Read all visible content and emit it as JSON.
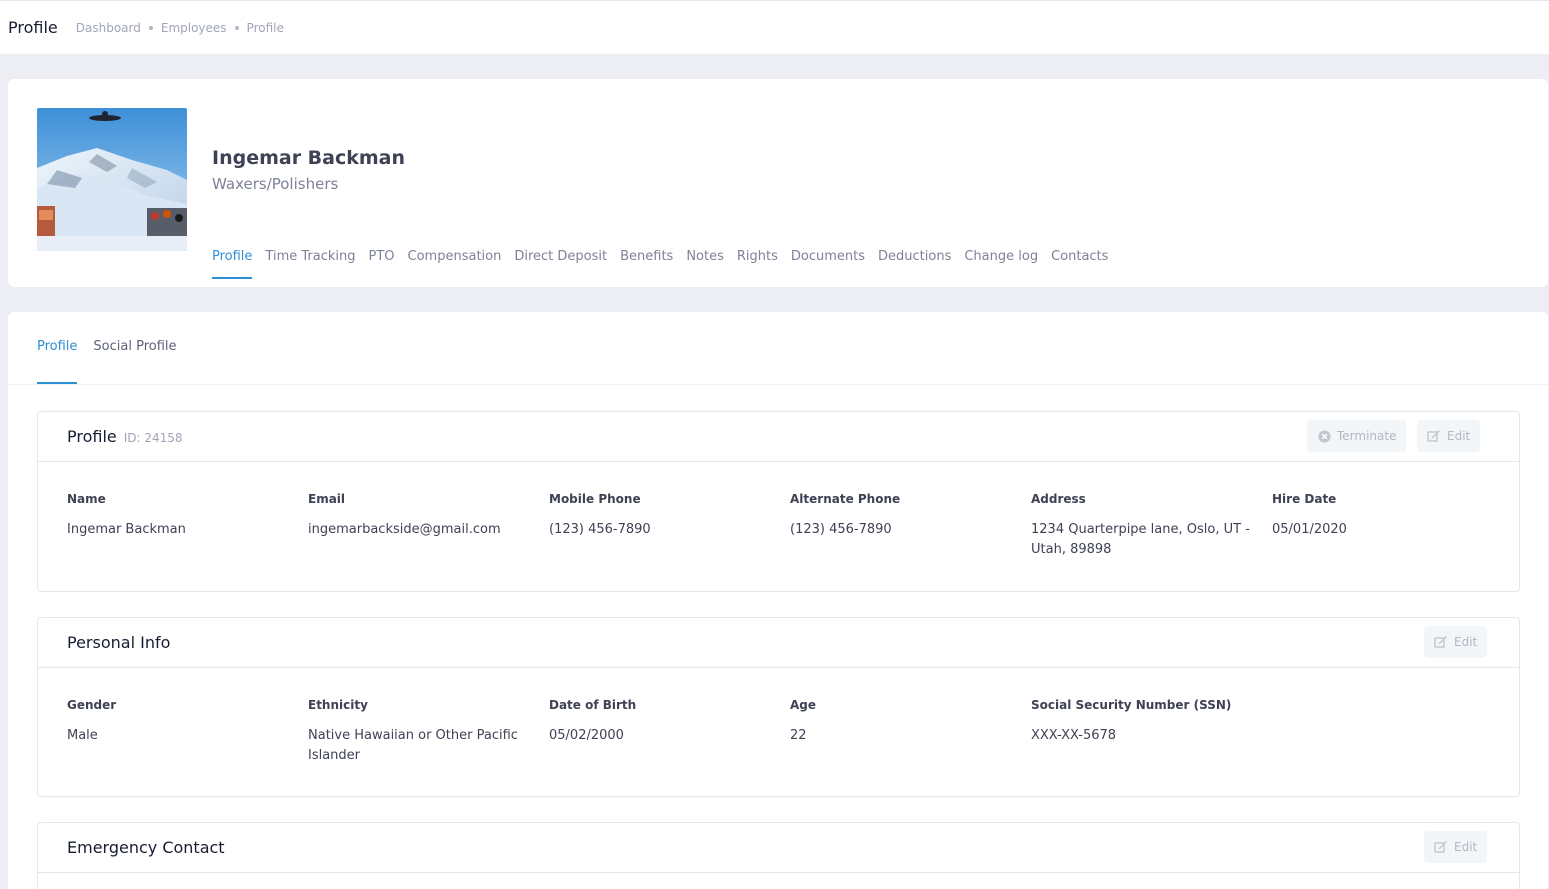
{
  "topbar": {
    "title": "Profile",
    "breadcrumbs": [
      "Dashboard",
      "Employees",
      "Profile"
    ]
  },
  "employee": {
    "name": "Ingemar Backman",
    "role": "Waxers/Polishers",
    "avatar_icon": "profile-photo-snowboarder"
  },
  "main_tabs": [
    {
      "label": "Profile",
      "active": true
    },
    {
      "label": "Time Tracking"
    },
    {
      "label": "PTO"
    },
    {
      "label": "Compensation"
    },
    {
      "label": "Direct Deposit"
    },
    {
      "label": "Benefits"
    },
    {
      "label": "Notes"
    },
    {
      "label": "Rights"
    },
    {
      "label": "Documents"
    },
    {
      "label": "Deductions"
    },
    {
      "label": "Change log"
    },
    {
      "label": "Contacts"
    }
  ],
  "sub_tabs": [
    {
      "label": "Profile",
      "active": true
    },
    {
      "label": "Social Profile"
    }
  ],
  "profile_section": {
    "title": "Profile",
    "id_text": "ID: 24158",
    "terminate_label": "Terminate",
    "edit_label": "Edit",
    "fields": [
      {
        "label": "Name",
        "value": "Ingemar Backman"
      },
      {
        "label": "Email",
        "value": "ingemarbackside@gmail.com"
      },
      {
        "label": "Mobile Phone",
        "value": "(123) 456-7890"
      },
      {
        "label": "Alternate Phone",
        "value": "(123) 456-7890"
      },
      {
        "label": "Address",
        "value": "1234 Quarterpipe lane, Oslo, UT - Utah, 89898"
      },
      {
        "label": "Hire Date",
        "value": "05/01/2020"
      }
    ]
  },
  "personal_section": {
    "title": "Personal Info",
    "edit_label": "Edit",
    "fields": [
      {
        "label": "Gender",
        "value": "Male"
      },
      {
        "label": "Ethnicity",
        "value": "Native Hawaiian or Other Pacific Islander"
      },
      {
        "label": "Date of Birth",
        "value": "05/02/2000"
      },
      {
        "label": "Age",
        "value": "22"
      },
      {
        "label": "Social Security Number (SSN)",
        "value": "XXX-XX-5678"
      }
    ]
  },
  "emergency_section": {
    "title": "Emergency Contact",
    "edit_label": "Edit"
  },
  "colors": {
    "accent": "#2d8fd5",
    "background": "#eceef4",
    "card": "#ffffff",
    "muted": "#a1a5b7"
  }
}
